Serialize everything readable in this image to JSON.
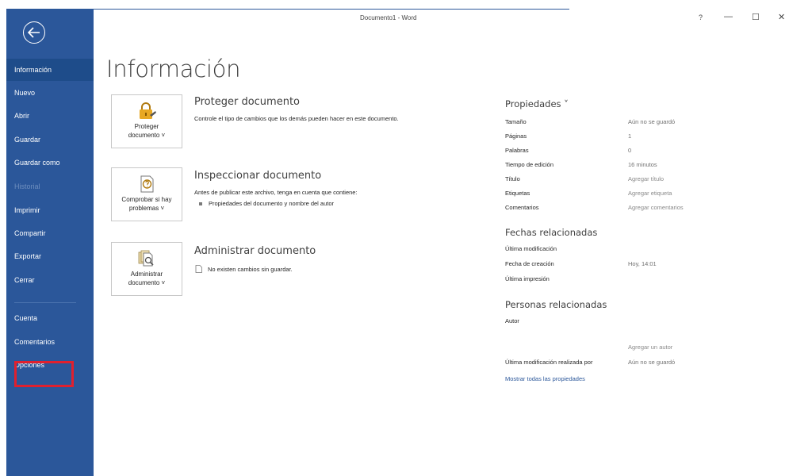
{
  "window": {
    "title": "Documento1  -  Word",
    "help": "?",
    "minimize": "—",
    "maximize": "☐",
    "close": "✕"
  },
  "sidebar": {
    "items": [
      {
        "label": "Información",
        "state": "active"
      },
      {
        "label": "Nuevo"
      },
      {
        "label": "Abrir"
      },
      {
        "label": "Guardar"
      },
      {
        "label": "Guardar como"
      },
      {
        "label": "Historial",
        "state": "disabled"
      },
      {
        "label": "Imprimir"
      },
      {
        "label": "Compartir"
      },
      {
        "label": "Exportar"
      },
      {
        "label": "Cerrar"
      },
      {
        "label": "Cuenta"
      },
      {
        "label": "Comentarios"
      },
      {
        "label": "Opciones",
        "state": "highlighted"
      }
    ]
  },
  "main": {
    "title": "Información",
    "sections": [
      {
        "button_line1": "Proteger",
        "button_line2": "documento ˅",
        "heading": "Proteger documento",
        "description": "Controle el tipo de cambios que los demás pueden hacer en este documento."
      },
      {
        "button_line1": "Comprobar si hay",
        "button_line2": "problemas ˅",
        "heading": "Inspeccionar documento",
        "description": "Antes de publicar este archivo, tenga en cuenta que contiene:",
        "bullet": "Propiedades del documento y nombre del autor"
      },
      {
        "button_line1": "Administrar",
        "button_line2": "documento ˅",
        "heading": "Administrar documento",
        "description": "No existen cambios sin guardar."
      }
    ]
  },
  "properties": {
    "heading": "Propiedades ˅",
    "rows": [
      {
        "label": "Tamaño",
        "value": "Aún no se guardó"
      },
      {
        "label": "Páginas",
        "value": "1"
      },
      {
        "label": "Palabras",
        "value": "0"
      },
      {
        "label": "Tiempo de edición",
        "value": "16 minutos"
      },
      {
        "label": "Título",
        "value": "Agregar título"
      },
      {
        "label": "Etiquetas",
        "value": "Agregar etiqueta"
      },
      {
        "label": "Comentarios",
        "value": "Agregar comentarios"
      }
    ],
    "dates_heading": "Fechas relacionadas",
    "dates": [
      {
        "label": "Última modificación",
        "value": ""
      },
      {
        "label": "Fecha de creación",
        "value": "Hoy, 14:01"
      },
      {
        "label": "Última impresión",
        "value": ""
      }
    ],
    "people_heading": "Personas relacionadas",
    "author_label": "Autor",
    "add_author": "Agregar un autor",
    "last_modified_by_label": "Última modificación realizada por",
    "last_modified_by_value": "Aún no se guardó",
    "show_all_link": "Mostrar todas las propiedades"
  },
  "colors": {
    "sidebar": "#2b579a",
    "highlight": "#e0202e",
    "link": "#2b579a"
  },
  "icons": [
    "back-arrow-icon",
    "lock-key-icon",
    "inspect-document-icon",
    "manage-document-icon",
    "document-small-icon"
  ]
}
